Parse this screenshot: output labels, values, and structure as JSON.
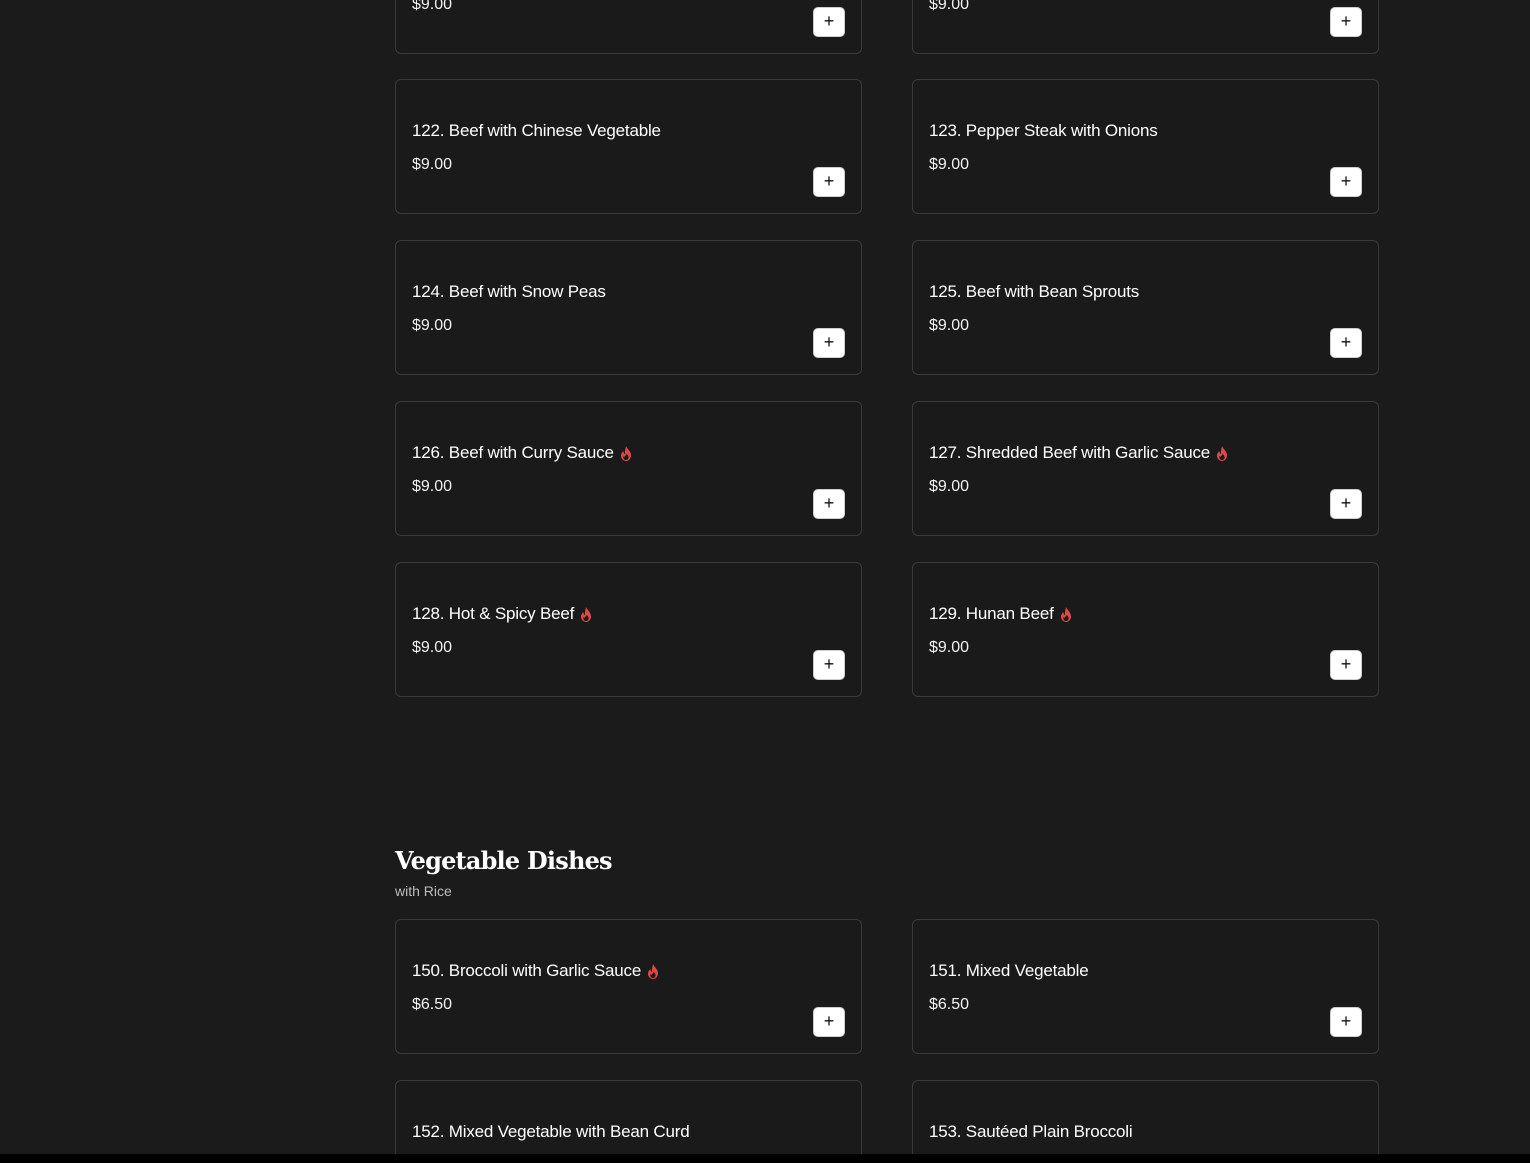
{
  "menu": {
    "items": [
      {
        "name": "",
        "price": "$9.00",
        "spicy": false
      },
      {
        "name": "",
        "price": "$9.00",
        "spicy": false
      },
      {
        "name": "122. Beef with Chinese Vegetable",
        "price": "$9.00",
        "spicy": false
      },
      {
        "name": "123. Pepper Steak with Onions",
        "price": "$9.00",
        "spicy": false
      },
      {
        "name": "124. Beef with Snow Peas",
        "price": "$9.00",
        "spicy": false
      },
      {
        "name": "125. Beef with Bean Sprouts",
        "price": "$9.00",
        "spicy": false
      },
      {
        "name": "126. Beef with Curry Sauce",
        "price": "$9.00",
        "spicy": true
      },
      {
        "name": "127. Shredded Beef with Garlic Sauce",
        "price": "$9.00",
        "spicy": true
      },
      {
        "name": "128. Hot & Spicy Beef",
        "price": "$9.00",
        "spicy": true
      },
      {
        "name": "129. Hunan Beef",
        "price": "$9.00",
        "spicy": true
      }
    ],
    "add_label": "+"
  },
  "vegetable_section": {
    "title": "Vegetable Dishes",
    "subtitle": "with Rice",
    "items": [
      {
        "name": "150. Broccoli with Garlic Sauce",
        "price": "$6.50",
        "spicy": true
      },
      {
        "name": "151. Mixed Vegetable",
        "price": "$6.50",
        "spicy": false
      },
      {
        "name": "152. Mixed Vegetable with Bean Curd",
        "price": "",
        "spicy": false
      },
      {
        "name": "153. Sautéed Plain Broccoli",
        "price": "",
        "spicy": false
      }
    ]
  },
  "colors": {
    "background": "#1b1b1b",
    "card_border": "#3a3a3a",
    "spicy": "#e04848",
    "button_bg": "#ffffff"
  },
  "icons": {
    "spicy": "flame-icon",
    "add": "plus-icon"
  }
}
